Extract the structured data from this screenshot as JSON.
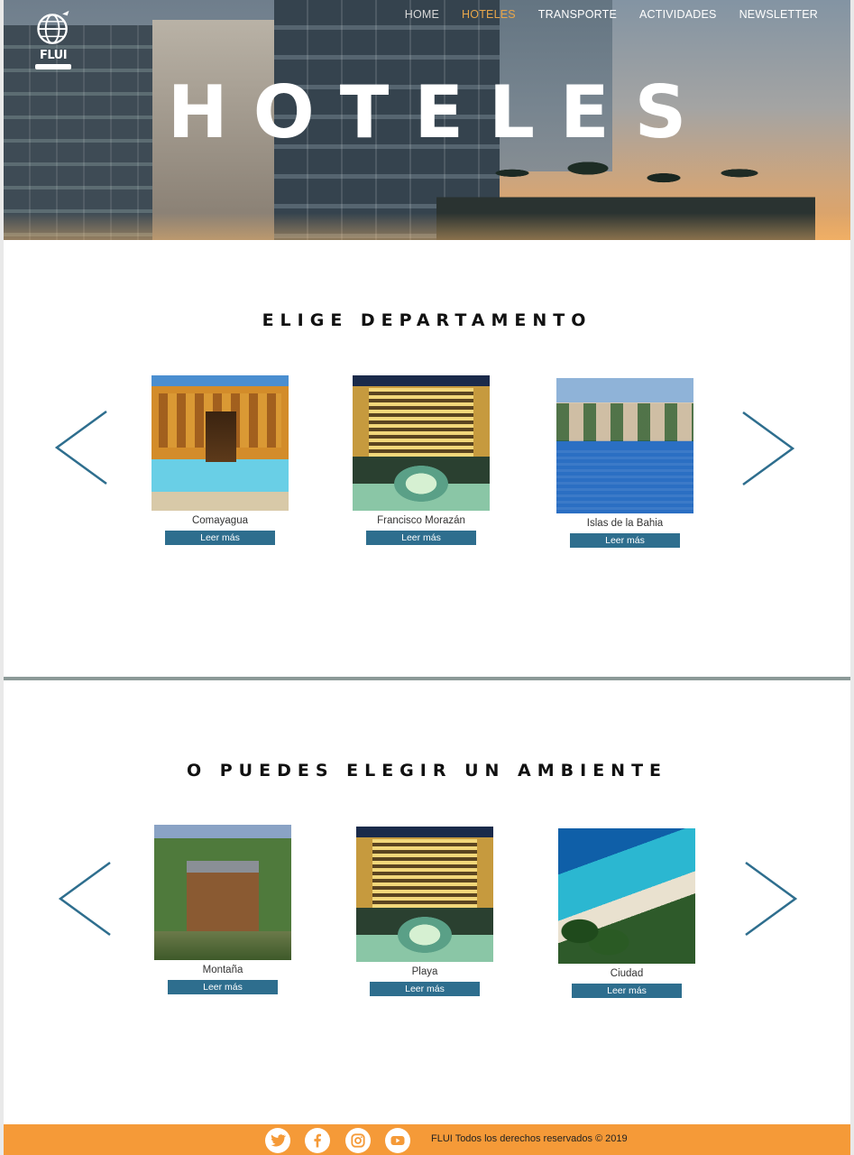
{
  "brand": {
    "logo_text": "FLUI",
    "colors": {
      "accent": "#e8a64a",
      "button": "#2e6e8e",
      "footer": "#f59a38",
      "arrow": "#2e6e8e"
    }
  },
  "nav": {
    "items": [
      {
        "label": "HOME"
      },
      {
        "label": "HOTELES"
      },
      {
        "label": "TRANSPORTE"
      },
      {
        "label": "ACTIVIDADES"
      },
      {
        "label": "NEWSLETTER"
      }
    ],
    "active": "HOTELES"
  },
  "hero": {
    "title": "HOTELES"
  },
  "section1": {
    "title": "ELIGE DEPARTAMENTO",
    "cards": [
      {
        "caption": "Comayagua",
        "button": "Leer más"
      },
      {
        "caption": "Francisco Morazán",
        "button": "Leer más"
      },
      {
        "caption": "Islas de la Bahia",
        "button": "Leer más"
      }
    ]
  },
  "section2": {
    "title": "O PUEDES ELEGIR UN AMBIENTE",
    "cards": [
      {
        "caption": "Montaña",
        "button": "Leer más"
      },
      {
        "caption": "Playa",
        "button": "Leer más"
      },
      {
        "caption": "Ciudad",
        "button": "Leer más"
      }
    ]
  },
  "footer": {
    "social": [
      "twitter-icon",
      "facebook-icon",
      "instagram-icon",
      "youtube-icon"
    ],
    "text": "FLUI  Todos los derechos reservados © 2019"
  }
}
